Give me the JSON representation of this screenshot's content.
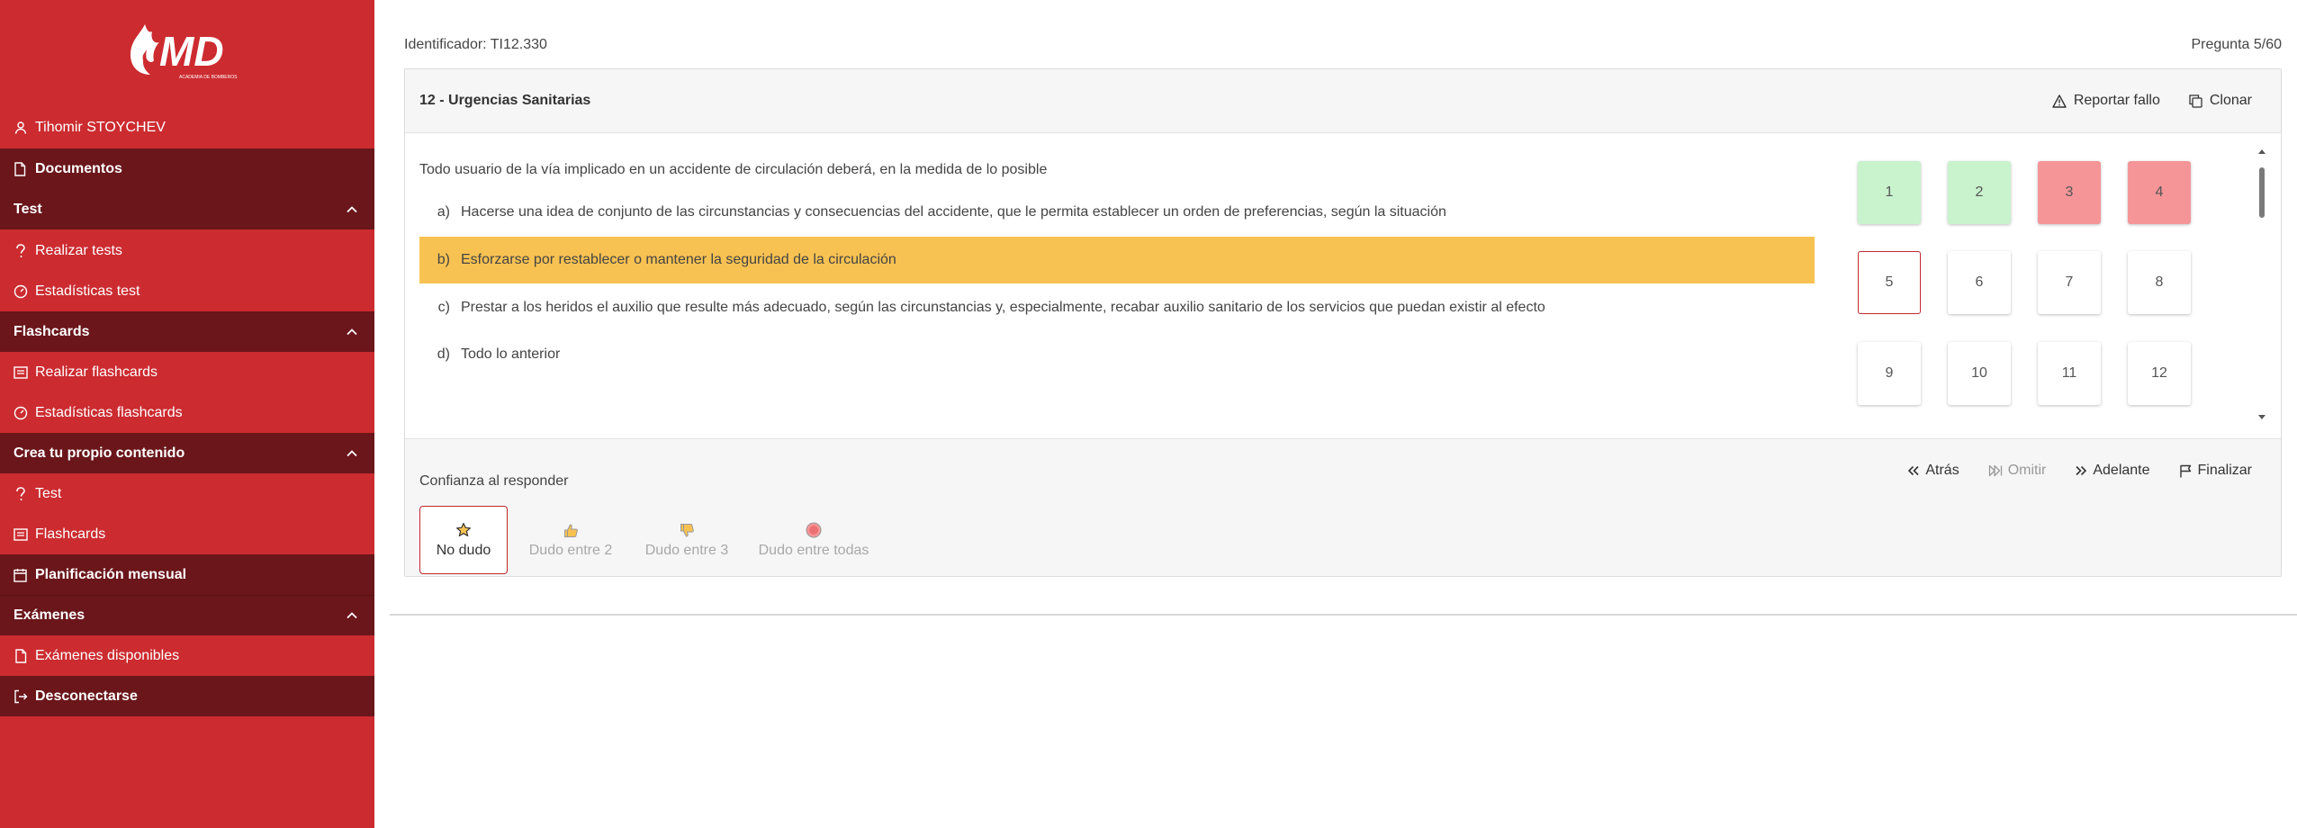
{
  "brand": {
    "logo_text": "MD",
    "logo_subtext": "ACADEMIA DE BOMBEROS"
  },
  "sidebar": {
    "user": "Tihomir STOYCHEV",
    "documentos": "Documentos",
    "sections": [
      {
        "title": "Test",
        "items": [
          "Realizar tests",
          "Estadísticas test"
        ]
      },
      {
        "title": "Flashcards",
        "items": [
          "Realizar flashcards",
          "Estadísticas flashcards"
        ]
      },
      {
        "title": "Crea tu propio contenido",
        "items": [
          "Test",
          "Flashcards"
        ]
      }
    ],
    "planificacion": "Planificación mensual",
    "examenes": {
      "title": "Exámenes",
      "items": [
        "Exámenes disponibles"
      ]
    },
    "logout": "Desconectarse"
  },
  "test": {
    "identifier": "Identificador: TI12.330",
    "progress": "Pregunta 5/60",
    "topic": "12 - Urgencias Sanitarias",
    "report_label": "Reportar fallo",
    "clone_label": "Clonar",
    "question": "Todo usuario de la vía implicado en un accidente de circulación deberá, en la medida de lo posible",
    "answers": [
      {
        "letter": "a)",
        "text": "Hacerse una idea de conjunto de las circunstancias y consecuencias del accidente, que le permita establecer un orden de preferencias, según la situación"
      },
      {
        "letter": "b)",
        "text": "Esforzarse por restablecer o mantener la seguridad de la circulación"
      },
      {
        "letter": "c)",
        "text": "Prestar a los heridos el auxilio que resulte más adecuado, según las circunstancias y, especialmente, recabar auxilio sanitario de los servicios que puedan existir al efecto"
      },
      {
        "letter": "d)",
        "text": "Todo lo anterior"
      }
    ],
    "selected_answer": "b)",
    "navigator": [
      {
        "n": "1",
        "status": "correct"
      },
      {
        "n": "2",
        "status": "correct"
      },
      {
        "n": "3",
        "status": "wrong"
      },
      {
        "n": "4",
        "status": "wrong"
      },
      {
        "n": "5",
        "status": "current"
      },
      {
        "n": "6",
        "status": "unanswered"
      },
      {
        "n": "7",
        "status": "unanswered"
      },
      {
        "n": "8",
        "status": "unanswered"
      },
      {
        "n": "9",
        "status": "unanswered"
      },
      {
        "n": "10",
        "status": "unanswered"
      },
      {
        "n": "11",
        "status": "unanswered"
      },
      {
        "n": "12",
        "status": "unanswered"
      }
    ],
    "confidence_label": "Confianza al responder",
    "confidence_options": [
      "No dudo",
      "Dudo entre 2",
      "Dudo entre 3",
      "Dudo entre todas"
    ],
    "confidence_selected": "No dudo",
    "nav": {
      "back": "Atrás",
      "skip": "Omitir",
      "forward": "Adelante",
      "finish": "Finalizar"
    }
  },
  "colors": {
    "sidebar_bg": "#cc2b30",
    "sidebar_dark": "#6a161a",
    "selected_answer": "#f8c252",
    "correct": "#c8f3cd",
    "wrong": "#f59598",
    "current_border": "#c0282e"
  }
}
